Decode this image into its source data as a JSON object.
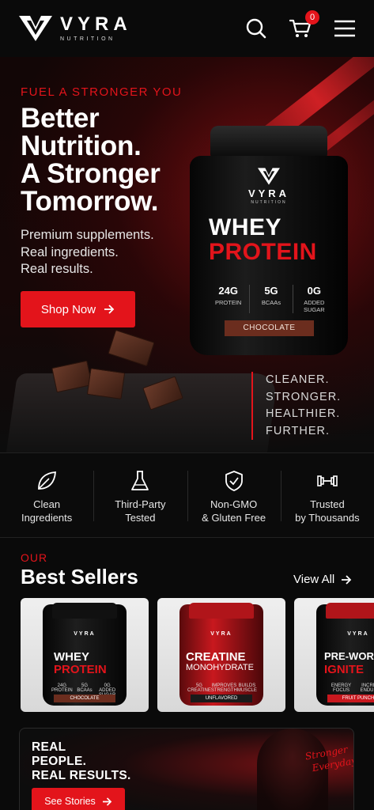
{
  "header": {
    "brand": "VYRA",
    "brand_sub": "NUTRITION",
    "cart_count": "0",
    "icons": [
      "search-icon",
      "cart-icon",
      "menu-icon"
    ]
  },
  "hero": {
    "eyebrow": "FUEL A STRONGER YOU",
    "headline": [
      "Better",
      "Nutrition.",
      "A Stronger",
      "Tomorrow."
    ],
    "subcopy": [
      "Premium supplements.",
      "Real ingredients.",
      "Real results."
    ],
    "cta_label": "Shop Now",
    "tagline": [
      "CLEANER.",
      "STRONGER.",
      "HEALTHIER.",
      "FURTHER."
    ],
    "product": {
      "brand": "VYRA",
      "brand_sub": "NUTRITION",
      "name_line1": "WHEY",
      "name_line2": "PROTEIN",
      "stats": [
        {
          "value": "24G",
          "label": "PROTEIN"
        },
        {
          "value": "5G",
          "label": "BCAAs"
        },
        {
          "value": "0G",
          "label": "ADDED SUGAR"
        }
      ],
      "flavor": "CHOCOLATE"
    }
  },
  "features": [
    {
      "icon": "leaf-icon",
      "line1": "Clean",
      "line2": "Ingredients"
    },
    {
      "icon": "flask-icon",
      "line1": "Third-Party",
      "line2": "Tested"
    },
    {
      "icon": "shield-check-icon",
      "line1": "Non-GMO",
      "line2": "& Gluten Free"
    },
    {
      "icon": "dumbbell-icon",
      "line1": "Trusted",
      "line2": "by Thousands"
    }
  ],
  "best_sellers": {
    "eyebrow": "OUR",
    "title": "Best Sellers",
    "view_all": "View All",
    "products": [
      {
        "line1": "WHEY",
        "line2": "PROTEIN",
        "stats": [
          "24G PROTEIN",
          "5G BCAAs",
          "0G ADDED SUGAR"
        ],
        "flavor": "CHOCOLATE"
      },
      {
        "line1": "CREATINE",
        "line2": "MONOHYDRATE",
        "stats": [
          "5G CREATINE",
          "IMPROVES STRENGTH",
          "BUILDS MUSCLE"
        ],
        "flavor": "UNFLAVORED"
      },
      {
        "line1": "PRE-WORK",
        "line2": "IGNITE",
        "stats": [
          "ENERGY FOCUS",
          "INCREASES ENDURANCE"
        ],
        "flavor": "FRUIT PUNCH"
      }
    ]
  },
  "stories": {
    "title": [
      "REAL",
      "PEOPLE.",
      "REAL RESULTS."
    ],
    "cta_label": "See Stories",
    "script": [
      "Stronger",
      "Everyday"
    ]
  },
  "colors": {
    "accent": "#e3141b",
    "background": "#0a0a0a",
    "flavor_chip": "#6b2d1e"
  }
}
